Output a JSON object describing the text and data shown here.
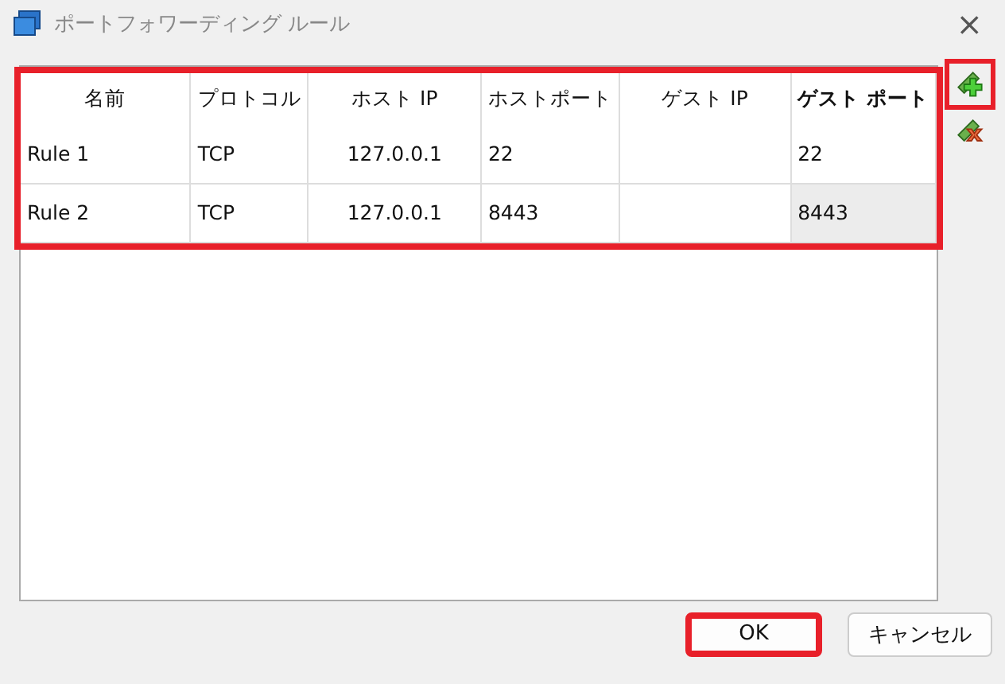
{
  "window": {
    "title": "ポートフォワーディング ルール",
    "close": "×"
  },
  "table": {
    "highlighted": true,
    "columns": [
      {
        "label": "名前",
        "current": false
      },
      {
        "label": "プロトコル",
        "current": false
      },
      {
        "label": "ホスト IP",
        "current": false
      },
      {
        "label": "ホストポート",
        "current": false
      },
      {
        "label": "ゲスト IP",
        "current": false
      },
      {
        "label": "ゲスト ポート",
        "current": true
      }
    ],
    "rows": [
      {
        "cells": [
          {
            "text": "Rule 1",
            "selected": false
          },
          {
            "text": "TCP",
            "selected": false
          },
          {
            "text": "127.0.0.1",
            "selected": false
          },
          {
            "text": "22",
            "selected": false
          },
          {
            "selected": false
          },
          {
            "text": "22",
            "selected": false
          }
        ]
      },
      {
        "cells": [
          {
            "text": "Rule 2",
            "selected": false
          },
          {
            "text": "TCP",
            "selected": false
          },
          {
            "text": "127.0.0.1",
            "selected": false
          },
          {
            "text": "8443",
            "selected": false
          },
          {
            "selected": false
          },
          {
            "text": "8443",
            "selected": true
          }
        ]
      }
    ]
  },
  "side_tools": [
    {
      "kind": "add",
      "highlighted": true
    },
    {
      "kind": "remove",
      "highlighted": false
    }
  ],
  "buttons": [
    {
      "label": "OK",
      "highlighted": true
    },
    {
      "label": "キャンセル",
      "highlighted": false
    }
  ]
}
